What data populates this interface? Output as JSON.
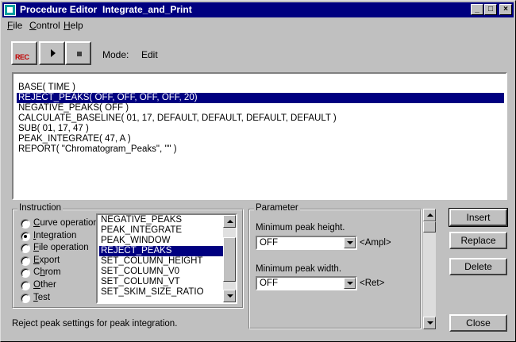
{
  "window": {
    "title": "Procedure Editor  Integrate_and_Print",
    "controls": [
      "minimize",
      "maximize",
      "close"
    ]
  },
  "menu": [
    {
      "label": "File",
      "accel": "F",
      "rest": "ile"
    },
    {
      "label": "Control",
      "accel": "C",
      "rest": "ontrol"
    },
    {
      "label": "Help",
      "accel": "H",
      "rest": "elp"
    }
  ],
  "toolbar": {
    "record_label": "REC",
    "play_icon": "play-icon",
    "stop_icon": "stop-icon",
    "mode_label": "Mode:",
    "mode_value": "Edit"
  },
  "script": {
    "lines": [
      "BASE( TIME )",
      "REJECT_PEAKS( OFF, OFF, OFF, OFF, 20)",
      "NEGATIVE_PEAKS( OFF )",
      "CALCULATE_BASELINE( 01, 17, DEFAULT, DEFAULT, DEFAULT, DEFAULT )",
      "SUB( 01, 17, 47 )",
      "PEAK_INTEGRATE( 47, A )",
      "REPORT( \"Chromatogram_Peaks\", \"\" )"
    ],
    "selected_index": 1
  },
  "instruction": {
    "title": "Instruction",
    "categories": [
      {
        "label": "Curve operation",
        "accel": "C",
        "rest": "urve operation",
        "checked": false
      },
      {
        "label": "Integration",
        "accel": "I",
        "rest": "ntegration",
        "checked": true
      },
      {
        "label": "File operation",
        "accel": "F",
        "rest": "ile operation",
        "checked": false
      },
      {
        "label": "Export",
        "accel": "E",
        "rest": "xport",
        "checked": false
      },
      {
        "label": "Chrom",
        "accel": "h",
        "pre": "C",
        "rest": "rom",
        "checked": false
      },
      {
        "label": "Other",
        "accel": "O",
        "rest": "ther",
        "checked": false
      },
      {
        "label": "Test",
        "accel": "T",
        "rest": "est",
        "checked": false
      }
    ],
    "commands": [
      "NEGATIVE_PEAKS",
      "PEAK_INTEGRATE",
      "PEAK_WINDOW",
      "REJECT_PEAKS",
      "SET_COLUMN_HEIGHT",
      "SET_COLUMN_V0",
      "SET_COLUMN_VT",
      "SET_SKIM_SIZE_RATIO"
    ],
    "selected_command_index": 3,
    "list_scroll_fraction": 0.55
  },
  "parameter": {
    "title": "Parameter",
    "fields": [
      {
        "label": "Minimum peak height.",
        "value": "OFF",
        "suffix": "<Ampl>"
      },
      {
        "label": "Minimum peak width.",
        "value": "OFF",
        "suffix": "<Ret>"
      }
    ]
  },
  "buttons": {
    "insert": "Insert",
    "replace": "Replace",
    "delete": "Delete",
    "close": "Close"
  },
  "status": "Reject peak settings for peak integration."
}
